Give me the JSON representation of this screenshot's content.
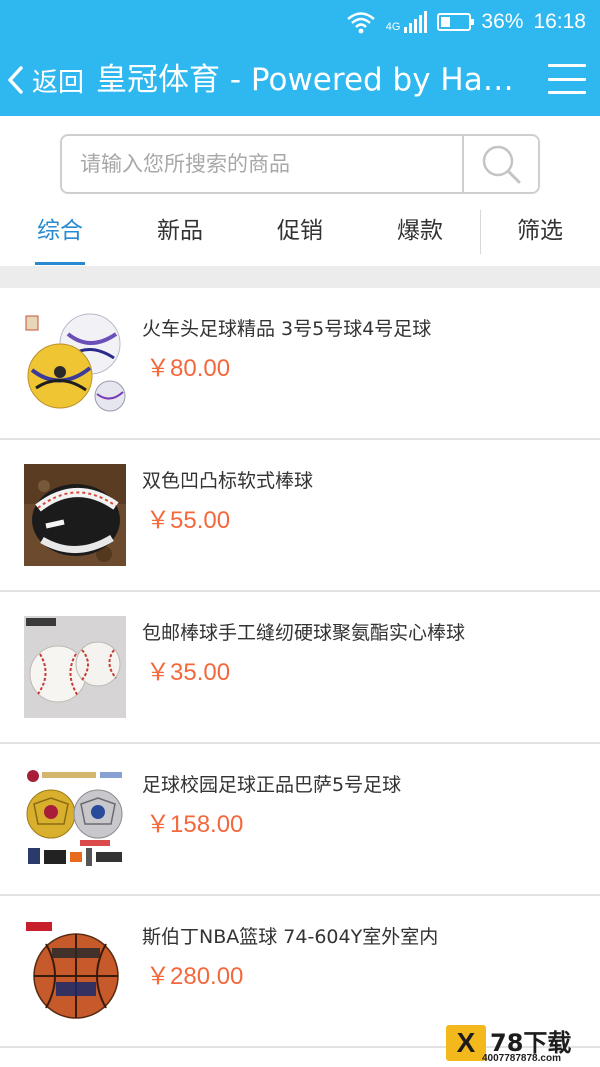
{
  "status_bar": {
    "network": "4G",
    "battery": "36%",
    "battery_level": 0.36,
    "time": "16:18"
  },
  "header": {
    "back_label": "返回",
    "title": "皇冠体育 - Powered by Hai..."
  },
  "search": {
    "placeholder": "请输入您所搜索的商品",
    "value": ""
  },
  "tabs": [
    {
      "label": "综合",
      "active": true
    },
    {
      "label": "新品",
      "active": false
    },
    {
      "label": "促销",
      "active": false
    },
    {
      "label": "爆款",
      "active": false
    },
    {
      "label": "筛选",
      "active": false
    }
  ],
  "products": [
    {
      "name": "火车头足球精品 3号5号球4号足球",
      "price": "￥80.00"
    },
    {
      "name": "双色凹凸标软式棒球",
      "price": "￥55.00"
    },
    {
      "name": "包邮棒球手工缝纫硬球聚氨酯实心棒球",
      "price": "￥35.00"
    },
    {
      "name": "足球校园足球正品巴萨5号足球",
      "price": "￥158.00"
    },
    {
      "name": "斯伯丁NBA篮球 74-604Y室外室内",
      "price": "￥280.00"
    }
  ],
  "watermark": {
    "logo_letter": "X",
    "name": "78下载",
    "site": "4007787878.com"
  },
  "colors": {
    "header_bg": "#2fb7f0",
    "active_tab": "#2a8ad0",
    "price": "#f4683c"
  }
}
